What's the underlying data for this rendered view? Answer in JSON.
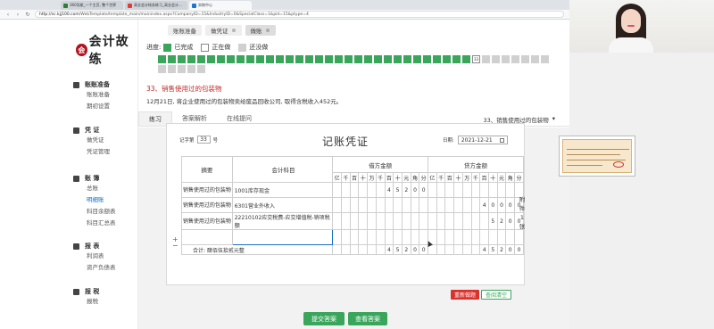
{
  "browser": {
    "tabs": [
      {
        "label": "360导航_一个主页, 整个世界",
        "icon": "globe-icon"
      },
      {
        "label": "高业会计帐务练习_高业会计...",
        "icon": "doc-icon"
      },
      {
        "label": "实帐中心",
        "icon": "doc-icon"
      }
    ],
    "url_prefix": "http://sc.kjj100.com",
    "url_path": "/WebTemplate/template_main/mainindex.aspx?CompanyID=15&IndustryID=0&SpecialClass=1&pid=15&ptype=4"
  },
  "logo": {
    "seal": "会",
    "text": "会计故练"
  },
  "top_tabs": [
    {
      "label": "账账准备"
    },
    {
      "label": "做凭证",
      "close": "⊗"
    },
    {
      "label": "做账",
      "close": "⊗"
    }
  ],
  "sidebar": {
    "groups": [
      {
        "title": "账账准备",
        "items": [
          "账账准备",
          "期初设置"
        ]
      },
      {
        "title": "凭 证",
        "items": [
          "做凭证",
          "凭证管理"
        ]
      },
      {
        "title": "账 簿",
        "items": [
          "总账",
          "明细账",
          "科目余额表",
          "科目汇总表"
        ]
      },
      {
        "title": "报 表",
        "items": [
          "利润表",
          "资产负债表"
        ]
      },
      {
        "title": "报 税",
        "items": [
          "报税"
        ]
      }
    ],
    "active_item": "明细账"
  },
  "progress": {
    "label": "进度:",
    "legend_done": "已完成",
    "legend_doing": "正在做",
    "legend_todo": "还没做",
    "total": 45,
    "current": 33
  },
  "question": {
    "title": "33、销售使用过的包装物",
    "description": "12月21日, 将企业使用过的包装物卖给废品回收公司, 取得含税收入452元。"
  },
  "subtabs": [
    "练习",
    "答案解析",
    "在线提问"
  ],
  "subtab_right": "33、销售使用过的包装物",
  "voucher": {
    "no_label": "记字第",
    "no_value": "33",
    "no_suffix": "号",
    "title": "记账凭证",
    "date_label": "日期:",
    "date_value": "2021-12-21",
    "col_summary": "摘要",
    "col_account": "会计科目",
    "col_debit": "借方金额",
    "col_credit": "贷方金额",
    "digits": [
      "亿",
      "千",
      "百",
      "十",
      "万",
      "千",
      "百",
      "十",
      "元",
      "角",
      "分"
    ],
    "rows": [
      {
        "summary": "销售使用过的包装物",
        "account": "1001库存现金",
        "debit": [
          "",
          "",
          "",
          "",
          "",
          "",
          "4",
          "5",
          "2",
          "0",
          "0"
        ],
        "credit": [
          "",
          "",
          "",
          "",
          "",
          "",
          "",
          "",
          "",
          "",
          ""
        ]
      },
      {
        "summary": "销售使用过的包装物",
        "account": "6301营业外收入",
        "debit": [
          "",
          "",
          "",
          "",
          "",
          "",
          "",
          "",
          "",
          "",
          ""
        ],
        "credit": [
          "",
          "",
          "",
          "",
          "",
          "",
          "4",
          "0",
          "0",
          "0",
          "0"
        ]
      },
      {
        "summary": "销售使用过的包装物",
        "account": "22210102应交税费-应交增值税-销项税额",
        "debit": [
          "",
          "",
          "",
          "",
          "",
          "",
          "",
          "",
          "",
          "",
          ""
        ],
        "credit": [
          "",
          "",
          "",
          "",
          "",
          "",
          "",
          "5",
          "2",
          "0",
          "0"
        ]
      },
      {
        "summary": "",
        "account": "",
        "debit": [
          "",
          "",
          "",
          "",
          "",
          "",
          "",
          "",
          "",
          "",
          ""
        ],
        "credit": [
          "",
          "",
          "",
          "",
          "",
          "",
          "",
          "",
          "",
          "",
          ""
        ]
      }
    ],
    "total_label": "合计: 肆佰伍拾贰元整",
    "total_debit": [
      "",
      "",
      "",
      "",
      "",
      "",
      "4",
      "5",
      "2",
      "0",
      "0"
    ],
    "total_credit": [
      "",
      "",
      "",
      "",
      "",
      "",
      "4",
      "5",
      "2",
      "0",
      "0"
    ],
    "attach_text": [
      "附",
      "件",
      "1",
      "张"
    ],
    "reset_button": "重新做题",
    "clear_button": "查阅清空"
  },
  "actions": {
    "submit": "提交答案",
    "view": "查看答案"
  },
  "colors": {
    "accent_green": "#3aa65c",
    "question_red": "#c62828",
    "link_blue": "#1a6fc4"
  }
}
